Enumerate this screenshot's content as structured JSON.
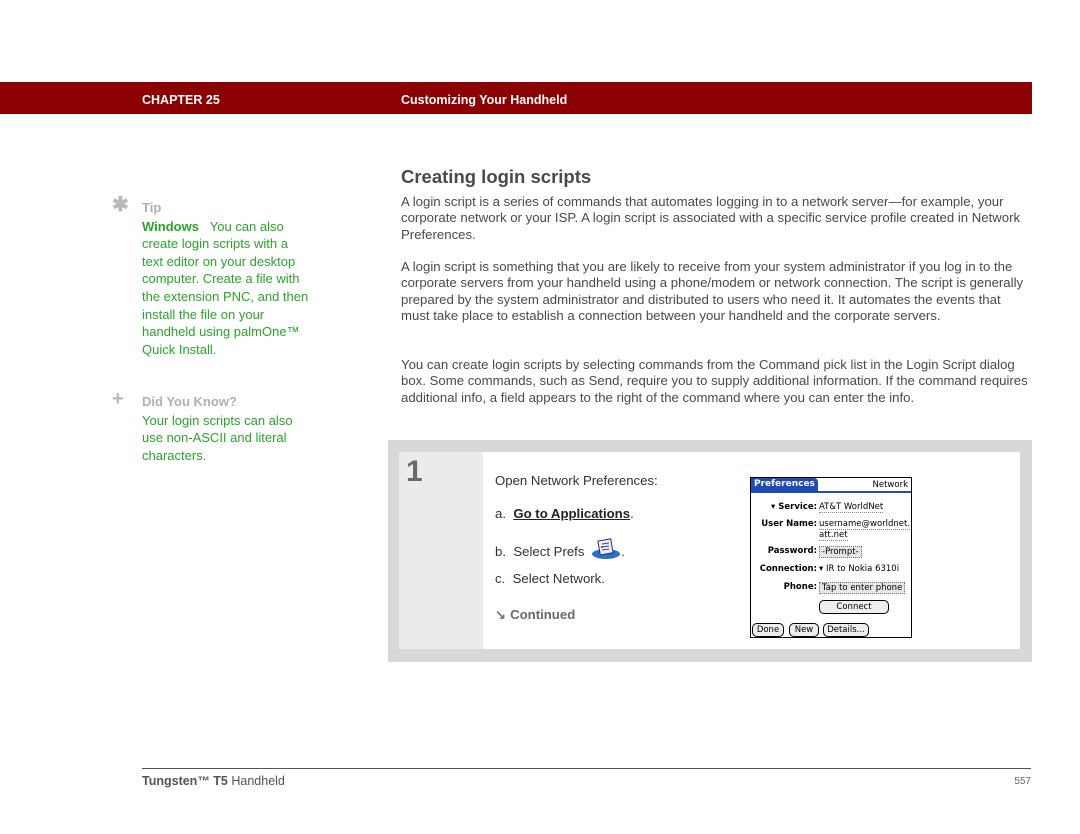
{
  "header": {
    "chapter": "CHAPTER 25",
    "title": "Customizing Your Handheld",
    "bar_color": "#8b0000"
  },
  "sidebar": {
    "tip": {
      "icon": "asterisk-icon",
      "label": "Tip",
      "platform": "Windows",
      "text": "You can also create login scripts with a text editor on your desktop computer. Create a file with the extension PNC, and then install the file on your handheld using palmOne™ Quick Install."
    },
    "did_you_know": {
      "icon": "plus-icon",
      "label": "Did You Know?",
      "text": "Your login scripts can also use non-ASCII and literal characters."
    },
    "text_color": "#2aa52a"
  },
  "main": {
    "heading": "Creating login scripts",
    "paragraphs": [
      "A login script is a series of commands that automates logging in to a network server—for example, your corporate network or your ISP. A login script is associated with a specific service profile created in Network Preferences.",
      "A login script is something that you are likely to receive from your system administrator if you log in to the corporate servers from your handheld using a phone/modem or network connection. The script is generally prepared by the system administrator and distributed to users who need it. It automates the events that must take place to establish a connection between your handheld and the corporate servers.",
      "You can create login scripts by selecting commands from the Command pick list in the Login Script dialog box. Some commands, such as Send, require you to supply additional information. If the command requires additional info, a field appears to the right of the command where you can enter the info."
    ]
  },
  "step": {
    "number": "1",
    "intro": "Open Network Preferences:",
    "items": [
      {
        "prefix": "a.",
        "link": "Go to Applications",
        "suffix": "."
      },
      {
        "prefix": "b.",
        "text": "Select Prefs",
        "suffix": "."
      },
      {
        "prefix": "c.",
        "text": "Select Network."
      }
    ],
    "continued": "Continued"
  },
  "palm_screen": {
    "title_tab": "Preferences",
    "title_right": "Network",
    "fields": {
      "service_label": "Service:",
      "service_value": "AT&T WorldNet",
      "username_label": "User Name:",
      "username_value_1": "username@worldnet.",
      "username_value_2": "att.net",
      "password_label": "Password:",
      "password_value": "-Prompt-",
      "connection_label": "Connection:",
      "connection_value": "IR to Nokia 6310i",
      "phone_label": "Phone:",
      "phone_value": "Tap to enter phone"
    },
    "buttons": {
      "connect": "Connect",
      "done": "Done",
      "new": "New",
      "details": "Details..."
    },
    "accent_color": "#1e4bb4"
  },
  "footer": {
    "product_bold": "Tungsten™ T5",
    "product_rest": " Handheld",
    "page_number": "557"
  }
}
